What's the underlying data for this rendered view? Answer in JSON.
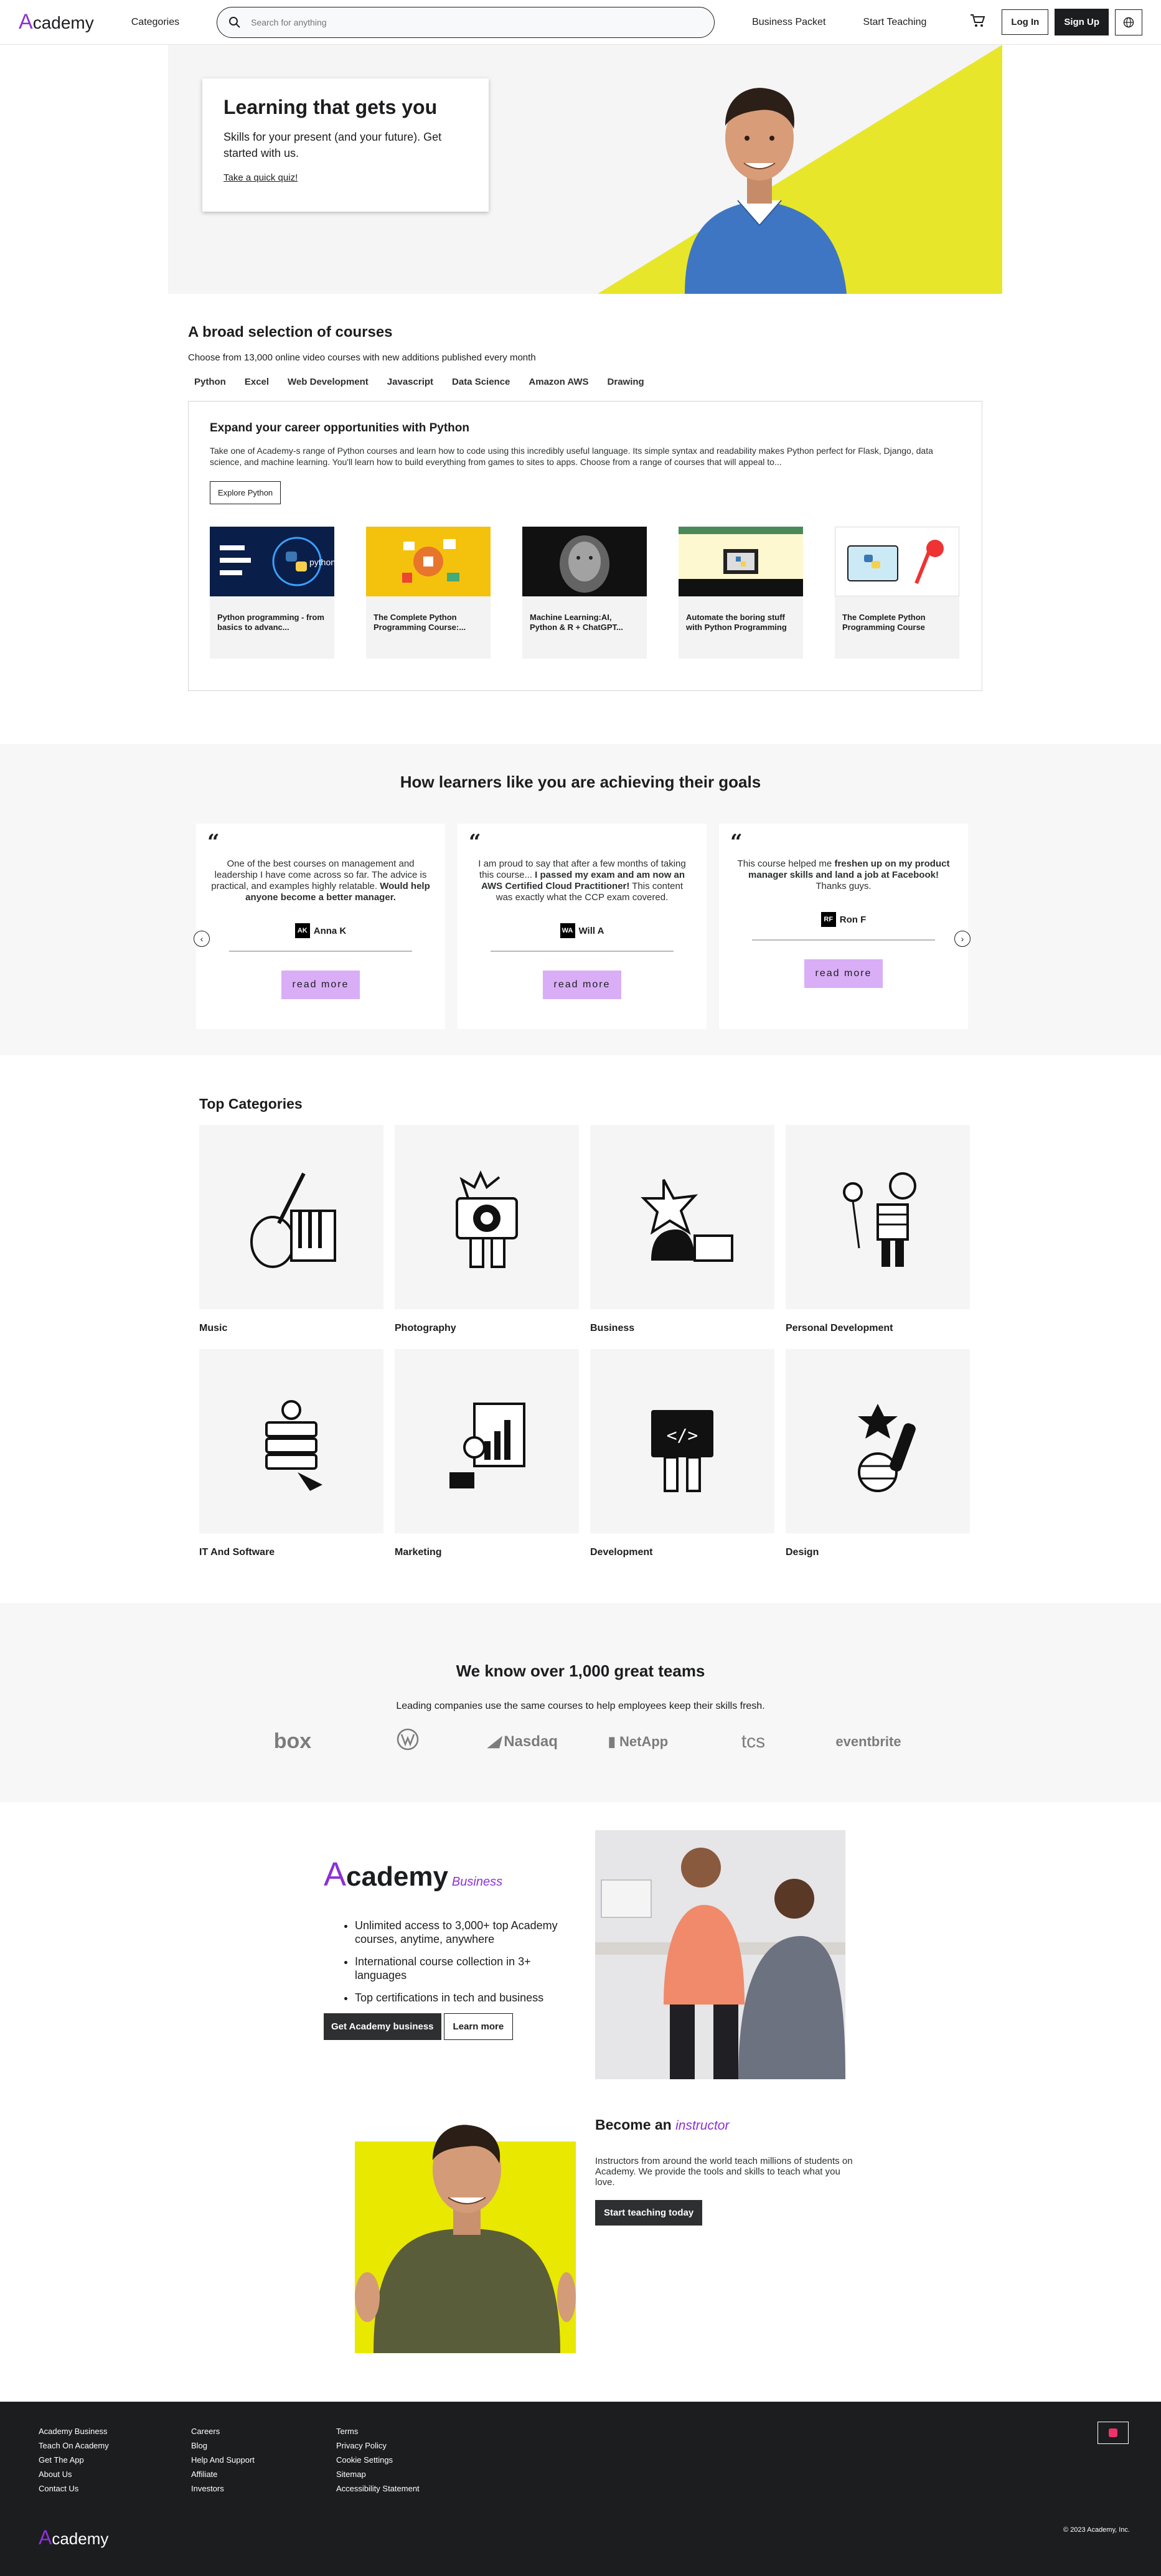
{
  "nav": {
    "logo_a": "A",
    "logo_rest": "cademy",
    "categories": "Categories",
    "search_placeholder": "Search for anything",
    "business": "Business Packet",
    "teach": "Start Teaching",
    "login": "Log In",
    "signup": "Sign Up"
  },
  "hero": {
    "title": "Learning that gets you",
    "subtitle": "Skills for your present (and your future). Get started with us.",
    "link": "Take a quick quiz!"
  },
  "broad": {
    "title": "A broad selection of courses",
    "subtitle": "Choose from 13,000 online video courses with new additions published every month",
    "tabs": [
      "Python",
      "Excel",
      "Web Development",
      "Javascript",
      "Data Science",
      "Amazon AWS",
      "Drawing"
    ],
    "box_title": "Expand your career opportunities with Python",
    "box_desc": "Take one of Academy-s range of Python courses and learn how to code using this incredibly useful language. Its simple syntax and readability makes Python perfect for Flask, Django, data science, and machine learning. You'll learn how to build everything from games to sites to apps. Choose from a range of courses that will appeal to...",
    "explore": "Explore Python",
    "courses": [
      {
        "title": "Python programming - from basics to advanc..."
      },
      {
        "title": "The Complete Python Programming Course:..."
      },
      {
        "title": "Machine Learning:AI, Python & R + ChatGPT..."
      },
      {
        "title": "Automate the boring stuff with Python Programming"
      },
      {
        "title": "The Complete Python Programming Course"
      }
    ]
  },
  "testimonials": {
    "title": "How learners like you are achieving their goals",
    "readmore": "read more",
    "items": [
      {
        "p1": "One of the best courses on management and leadership I have come across so far. The advice is practical, and examples highly relatable. ",
        "bold": "Would help anyone become a better manager.",
        "p2": "",
        "initials": "AK",
        "name": "Anna K"
      },
      {
        "p1": "I am proud to say that after a few months of taking this course...",
        "bold": "I passed my exam and am now an AWS Certified Cloud Practitioner!",
        "p2": " This content was exactly what the CCP exam covered.",
        "initials": "WA",
        "name": "Will A"
      },
      {
        "p1": "This course helped me ",
        "bold": "freshen up on my product manager skills and land a job at Facebook!",
        "p2": " Thanks guys.",
        "initials": "RF",
        "name": "Ron F"
      }
    ]
  },
  "topcats": {
    "title": "Top Categories",
    "items": [
      "Music",
      "Photography",
      "Business",
      "Personal Development",
      "IT And Software",
      "Marketing",
      "Development",
      "Design"
    ]
  },
  "teams": {
    "title": "We know over 1,000 great teams",
    "subtitle": "Leading companies use the same courses to help employees keep their skills fresh.",
    "logos": [
      "box",
      "VW",
      "Nasdaq",
      "NetApp",
      "tcs",
      "eventbrite"
    ]
  },
  "business": {
    "logo_a": "A",
    "logo_rest": "cademy",
    "word": "Business",
    "bullets": [
      "Unlimited access to 3,000+ top Academy courses, anytime, anywhere",
      "International course collection in 3+ languages",
      "Top certifications in tech and business"
    ],
    "btn_primary": "Get Academy business",
    "btn_secondary": "Learn more"
  },
  "instructor": {
    "title_a": "Become an ",
    "title_b": "instructor",
    "desc": "Instructors from around the world teach millions of students on Academy. We provide the tools and skills to teach what you love.",
    "btn": "Start teaching today"
  },
  "footer": {
    "col1": [
      "Academy Business",
      "Teach On Academy",
      "Get The App",
      "About Us",
      "Contact Us"
    ],
    "col2": [
      "Careers",
      "Blog",
      "Help And Support",
      "Affiliate",
      "Investors"
    ],
    "col3": [
      "Terms",
      "Privacy Policy",
      "Cookie Settings",
      "Sitemap",
      "Accessibility Statement"
    ],
    "logo_a": "A",
    "logo_rest": "cademy",
    "copyright": "© 2023 Academy, Inc."
  }
}
